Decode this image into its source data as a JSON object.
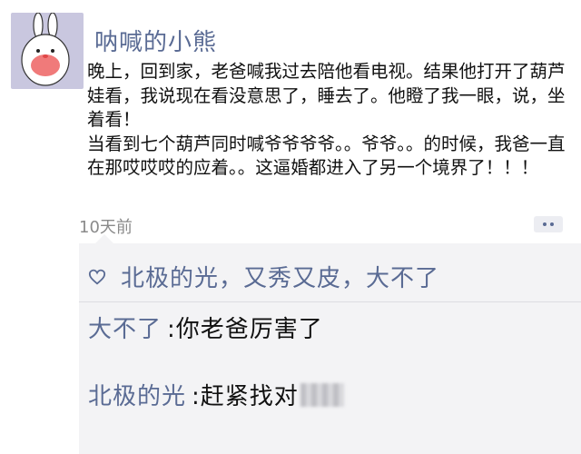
{
  "post": {
    "username": "呐喊的小熊",
    "text": "晚上，回到家，老爸喊我过去陪他看电视。结果他打开了葫芦娃看，我说现在看没意思了，睡去了。他瞪了我一眼，说，坐着看！\n当看到七个葫芦同时喊爷爷爷爷。。爷爷。。的时候，我爸一直在那哎哎哎的应着。。这逼婚都进入了另一个境界了！！！",
    "timestamp": "10天前",
    "avatar_icon": "bunny-avatar-icon"
  },
  "likes": {
    "icon": "heart-outline-icon",
    "names": "北极的光，又秀又皮，大不了"
  },
  "comments": [
    {
      "author": "大不了",
      "text": "你老爸厉害了"
    },
    {
      "author": "北极的光",
      "text": "赶紧找对"
    }
  ],
  "colors": {
    "name_blue": "#5a6b94",
    "comment_bg": "#f3f3f5",
    "avatar_bg": "#c9c7df"
  }
}
